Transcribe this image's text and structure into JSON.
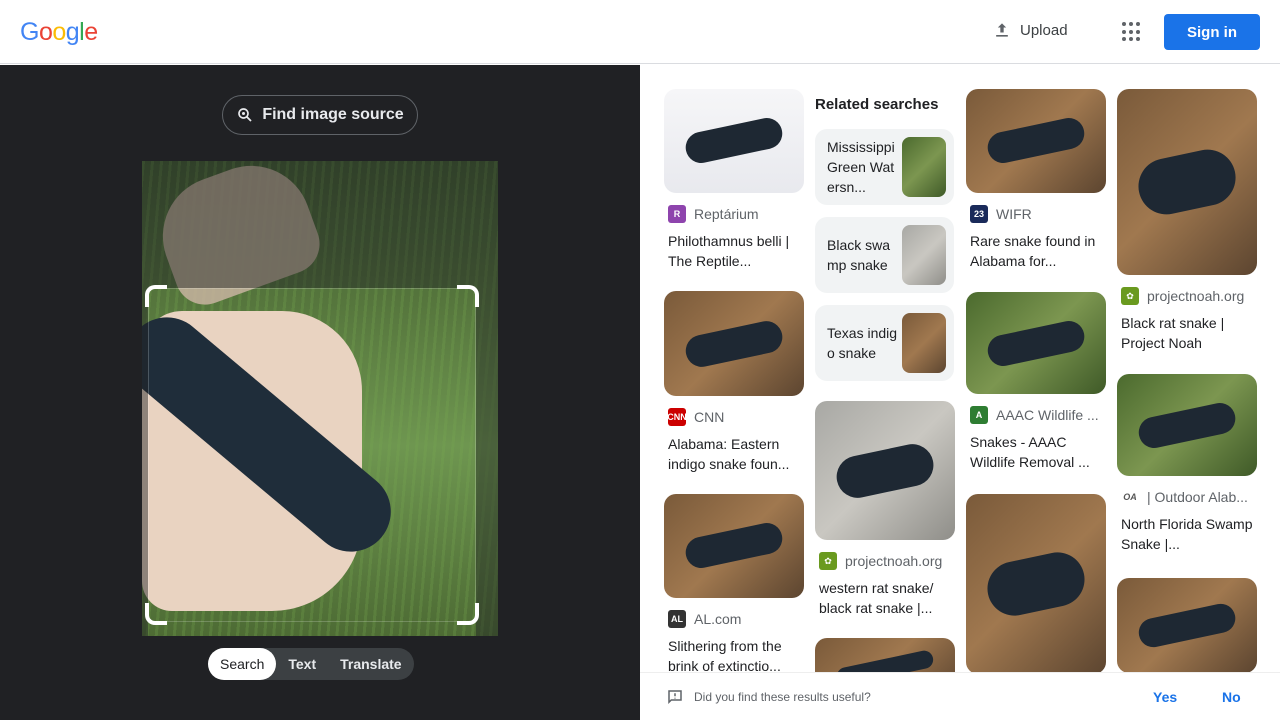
{
  "header": {
    "logo_letters": [
      "G",
      "o",
      "o",
      "g",
      "l",
      "e"
    ],
    "upload_label": "Upload",
    "signin_label": "Sign in"
  },
  "lens": {
    "find_source_label": "Find image source",
    "modes": [
      "Search",
      "Text",
      "Translate"
    ],
    "active_mode": "Search"
  },
  "related": {
    "heading": "Related searches",
    "items": [
      {
        "label": "Mississippi Green Watersn..."
      },
      {
        "label": "Black swamp snake"
      },
      {
        "label": "Texas indigo snake"
      }
    ]
  },
  "results": [
    {
      "source": "Reptárium",
      "title": "Philothamnus belli | The Reptile...",
      "fav_color": "#8e44ad"
    },
    {
      "source": "CNN",
      "title": "Alabama: Eastern indigo snake foun...",
      "fav_color": "#cc0000"
    },
    {
      "source": "AL.com",
      "title": "Slithering from the brink of extinctio...",
      "fav_color": "#333333"
    },
    {
      "source": "projectnoah.org",
      "title": "western rat snake/ black rat snake |...",
      "fav_color": "#6a9a1f"
    },
    {
      "source": "WIFR",
      "title": "Rare snake found in Alabama for...",
      "fav_color": "#1a2a5a"
    },
    {
      "source": "AAAC Wildlife ...",
      "title": "Snakes - AAAC Wildlife Removal ...",
      "fav_color": "#2e7d32"
    },
    {
      "source": "projectnoah.org",
      "title": "Black rat snake | Project Noah",
      "fav_color": "#6a9a1f"
    },
    {
      "source": "| Outdoor Alab...",
      "title": "North Florida Swamp Snake |...",
      "fav_color": "#555555"
    }
  ],
  "feedback": {
    "question": "Did you find these results useful?",
    "yes": "Yes",
    "no": "No"
  }
}
